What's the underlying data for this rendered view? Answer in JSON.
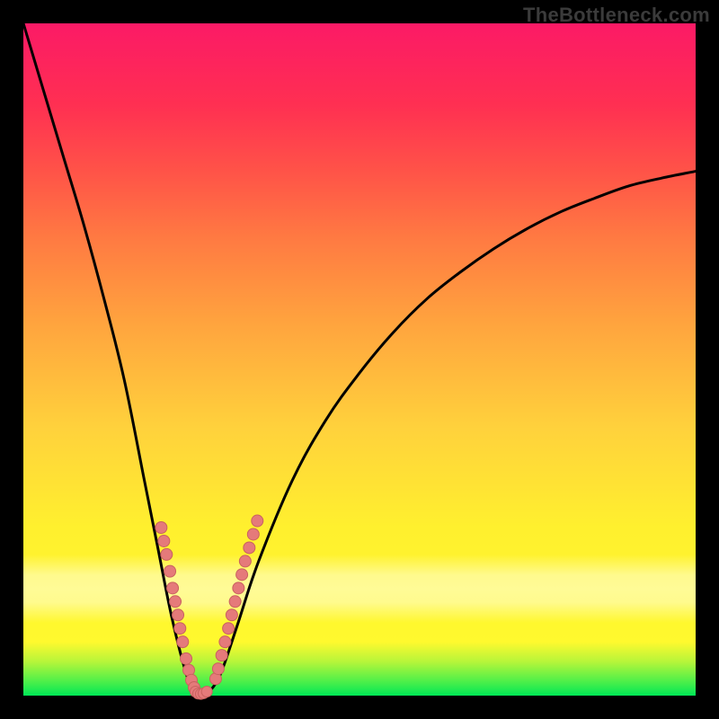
{
  "watermark": "TheBottleneck.com",
  "colors": {
    "curve_stroke": "#000000",
    "marker_fill": "#e57a7a",
    "marker_stroke": "#c9625f"
  },
  "chart_data": {
    "type": "line",
    "title": "",
    "xlabel": "",
    "ylabel": "",
    "xlim": [
      0,
      100
    ],
    "ylim": [
      0,
      100
    ],
    "grid": false,
    "legend": false,
    "description": "Approximate V-shaped mismatch/bottleneck curve on a rainbow gradient. Minimum ≈0 around x≈26. Values rise steeply toward both ends; y(0)≈100, y(100)≈78. Axis scales are unlabeled; values read as percent of plot height.",
    "series": [
      {
        "name": "curve",
        "x": [
          0,
          3,
          6,
          9,
          12,
          15,
          18,
          20,
          22,
          24,
          25,
          26,
          27,
          28,
          29,
          30,
          32,
          35,
          40,
          45,
          50,
          55,
          60,
          65,
          70,
          75,
          80,
          85,
          90,
          95,
          100
        ],
        "y": [
          100,
          90,
          80,
          70,
          59,
          47,
          32,
          22,
          12,
          4,
          1.5,
          0.2,
          0.2,
          1.0,
          2.5,
          5,
          11,
          20,
          32,
          41,
          48,
          54,
          59,
          63,
          66.5,
          69.5,
          72,
          74,
          75.8,
          77,
          78
        ]
      }
    ],
    "markers_left": [
      {
        "x": 20.5,
        "y": 25
      },
      {
        "x": 20.9,
        "y": 23
      },
      {
        "x": 21.3,
        "y": 21
      },
      {
        "x": 21.8,
        "y": 18.5
      },
      {
        "x": 22.2,
        "y": 16
      },
      {
        "x": 22.6,
        "y": 14
      },
      {
        "x": 23.0,
        "y": 12
      },
      {
        "x": 23.3,
        "y": 10
      },
      {
        "x": 23.7,
        "y": 8
      },
      {
        "x": 24.2,
        "y": 5.5
      },
      {
        "x": 24.6,
        "y": 3.8
      },
      {
        "x": 25.0,
        "y": 2.3
      },
      {
        "x": 25.4,
        "y": 1.2
      }
    ],
    "markers_bottom": [
      {
        "x": 25.6,
        "y": 0.6
      },
      {
        "x": 26.0,
        "y": 0.3
      },
      {
        "x": 26.4,
        "y": 0.25
      },
      {
        "x": 26.8,
        "y": 0.35
      },
      {
        "x": 27.3,
        "y": 0.6
      }
    ],
    "markers_right": [
      {
        "x": 28.6,
        "y": 2.5
      },
      {
        "x": 29.0,
        "y": 4
      },
      {
        "x": 29.5,
        "y": 6
      },
      {
        "x": 30.0,
        "y": 8
      },
      {
        "x": 30.5,
        "y": 10
      },
      {
        "x": 31.0,
        "y": 12
      },
      {
        "x": 31.5,
        "y": 14
      },
      {
        "x": 32.0,
        "y": 16
      },
      {
        "x": 32.5,
        "y": 18
      },
      {
        "x": 33.0,
        "y": 20
      },
      {
        "x": 33.6,
        "y": 22
      },
      {
        "x": 34.2,
        "y": 24
      },
      {
        "x": 34.8,
        "y": 26
      }
    ]
  }
}
